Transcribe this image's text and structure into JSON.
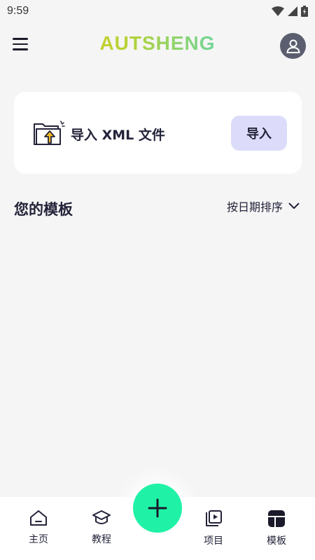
{
  "status_bar": {
    "time": "9:59"
  },
  "app_bar": {
    "logo": "AUTSHENG"
  },
  "import_card": {
    "label": "导入 XML 文件",
    "button": "导入"
  },
  "templates": {
    "title": "您的模板",
    "sort_label": "按日期排序"
  },
  "bottom_nav": {
    "items": [
      {
        "label": "主页",
        "icon": "home-icon"
      },
      {
        "label": "教程",
        "icon": "graduation-cap-icon"
      },
      {
        "label": "项目",
        "icon": "video-project-icon"
      },
      {
        "label": "模板",
        "icon": "template-icon",
        "active": true
      }
    ],
    "fab_icon": "plus-icon"
  },
  "colors": {
    "accent": "#1ff2a6",
    "import_button_bg": "#dcdcfa",
    "avatar_bg": "#5a5e6e",
    "logo_gradient": [
      "#f2c521",
      "#b7d233",
      "#5fd6b0",
      "#18d6d0"
    ]
  }
}
